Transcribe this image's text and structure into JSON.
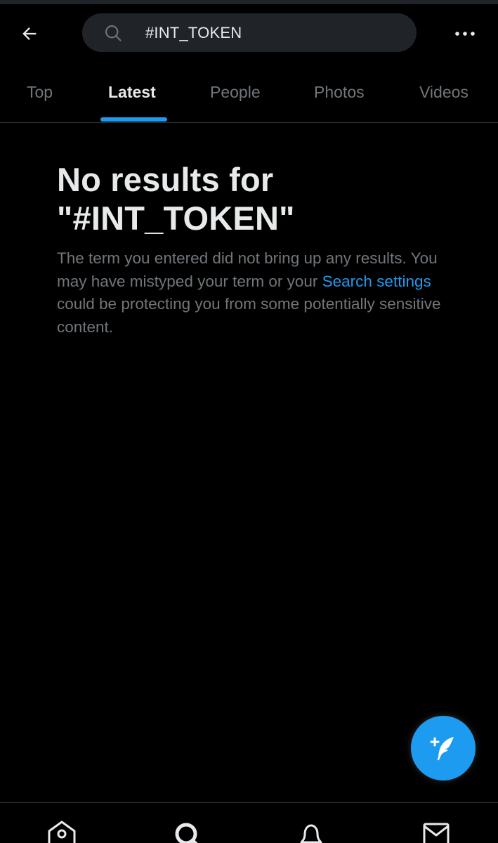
{
  "header": {
    "search_value": "#INT_TOKEN"
  },
  "tabs": [
    {
      "label": "Top",
      "active": false
    },
    {
      "label": "Latest",
      "active": true
    },
    {
      "label": "People",
      "active": false
    },
    {
      "label": "Photos",
      "active": false
    },
    {
      "label": "Videos",
      "active": false
    }
  ],
  "empty_state": {
    "title_line1": "No results for",
    "title_line2": "\"#INT_TOKEN\"",
    "text_before_link": "The term you entered did not bring up any results. You may have mistyped your term or your ",
    "link_text": "Search settings",
    "text_after_link": " could be protecting you from some potentially sensitive content."
  },
  "icons": {
    "back": "arrow-left-icon",
    "search": "search-icon",
    "more": "more-horizontal-icon",
    "compose": "compose-feather-icon",
    "nav_home": "home-icon",
    "nav_search": "search-icon",
    "nav_notifications": "bell-icon",
    "nav_messages": "mail-icon"
  },
  "colors": {
    "accent": "#1d9bf0",
    "background": "#000000",
    "primary_text": "#e7e9ea",
    "secondary_text": "#71767b",
    "search_bg": "#202327",
    "divider": "#2f3336"
  }
}
